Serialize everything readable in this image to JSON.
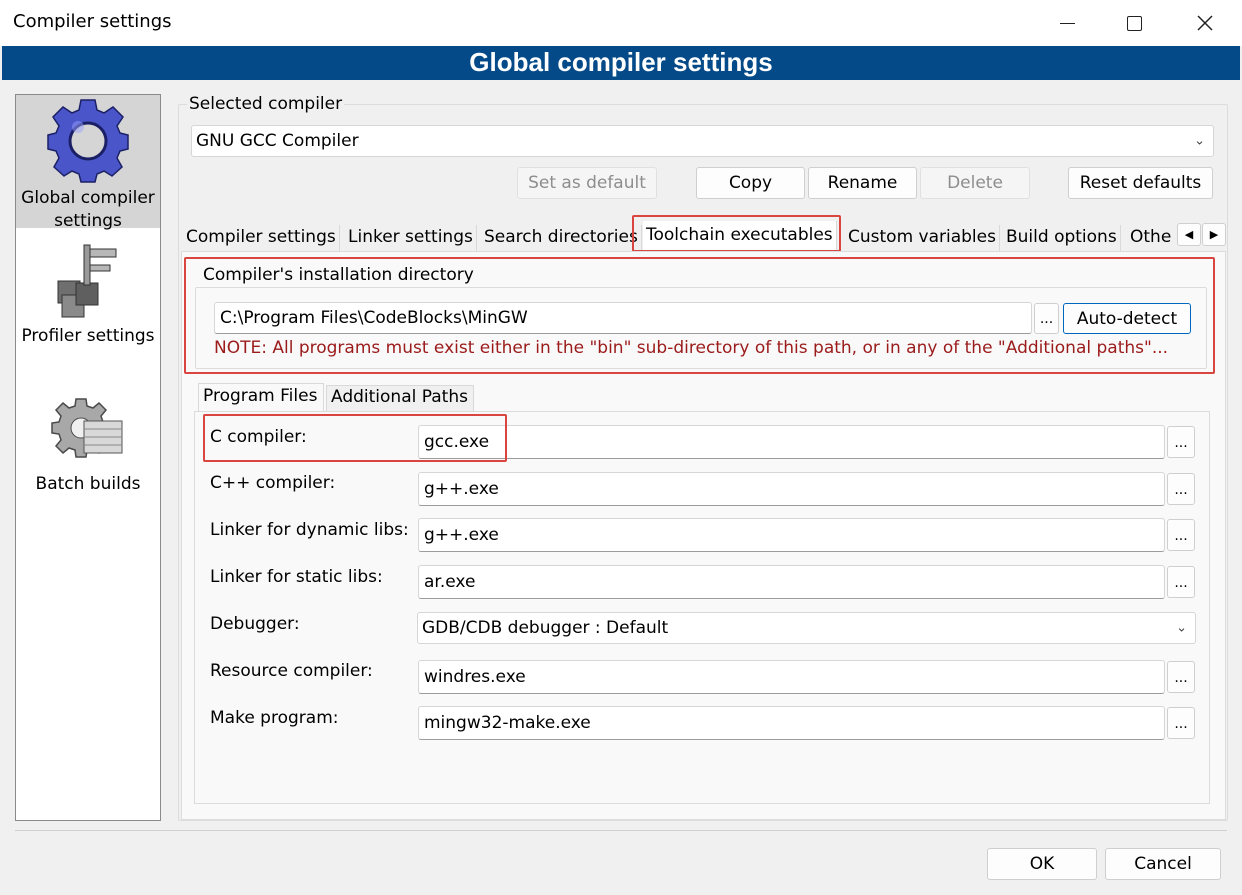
{
  "window": {
    "title": "Compiler settings",
    "banner": "Global compiler settings"
  },
  "sidebar": {
    "items": [
      {
        "label_line1": "Global compiler",
        "label_line2": "settings",
        "icon": "gear-icon",
        "selected": true
      },
      {
        "label": "Profiler settings",
        "icon": "profiler-icon"
      },
      {
        "label": "Batch builds",
        "icon": "batch-builds-icon"
      }
    ]
  },
  "compiler_select": {
    "group_label": "Selected compiler",
    "value": "GNU GCC Compiler",
    "buttons": {
      "set_default": "Set as default",
      "copy": "Copy",
      "rename": "Rename",
      "delete": "Delete",
      "reset": "Reset defaults"
    }
  },
  "tabs": [
    "Compiler settings",
    "Linker settings",
    "Search directories",
    "Toolchain executables",
    "Custom variables",
    "Build options",
    "Othe"
  ],
  "active_tab": "Toolchain executables",
  "install_dir": {
    "group_label": "Compiler's installation directory",
    "path": "C:\\Program Files\\CodeBlocks\\MinGW",
    "browse": "...",
    "auto_detect": "Auto-detect",
    "note": "NOTE: All programs must exist either in the \"bin\" sub-directory of this path, or in any of the \"Additional paths\"..."
  },
  "subtabs": {
    "program_files": "Program Files",
    "additional_paths": "Additional Paths"
  },
  "programs": {
    "c_compiler": {
      "label": "C compiler:",
      "value": "gcc.exe"
    },
    "cpp_compiler": {
      "label": "C++ compiler:",
      "value": "g++.exe"
    },
    "linker_dynamic": {
      "label": "Linker for dynamic libs:",
      "value": "g++.exe"
    },
    "linker_static": {
      "label": "Linker for static libs:",
      "value": "ar.exe"
    },
    "debugger": {
      "label": "Debugger:",
      "value": "GDB/CDB debugger : Default"
    },
    "resource_compiler": {
      "label": "Resource compiler:",
      "value": "windres.exe"
    },
    "make_program": {
      "label": "Make program:",
      "value": "mingw32-make.exe"
    },
    "browse": "..."
  },
  "footer": {
    "ok": "OK",
    "cancel": "Cancel"
  },
  "colors": {
    "banner_bg": "#054a88",
    "highlight": "#d9463f",
    "note_text": "#9b1b1b"
  }
}
